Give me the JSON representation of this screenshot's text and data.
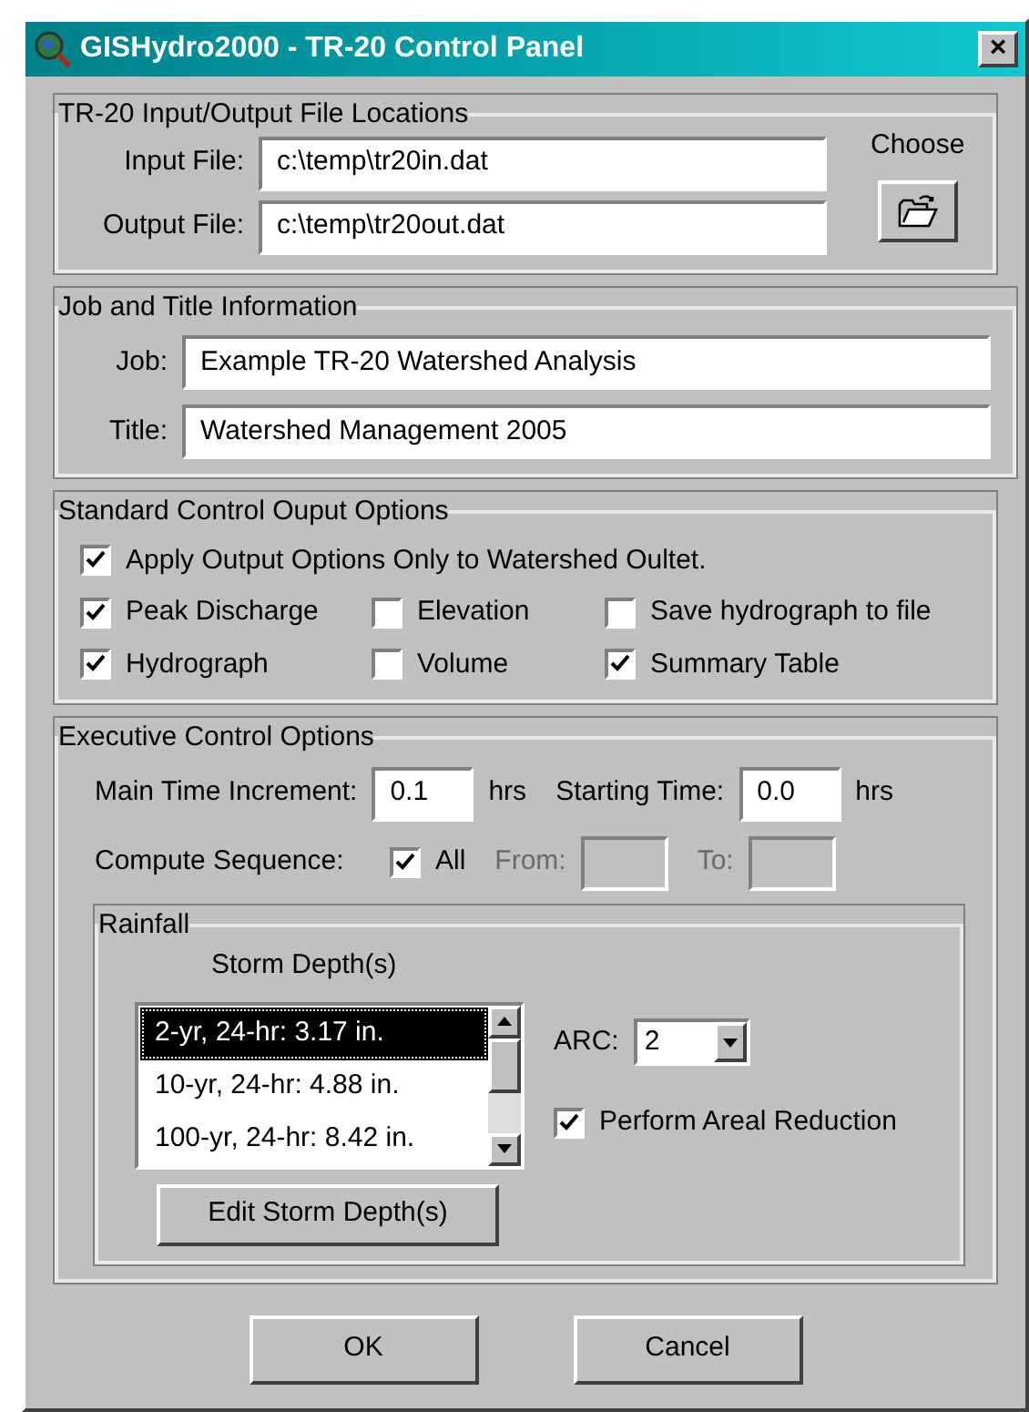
{
  "window": {
    "title": "GISHydro2000 - TR-20 Control Panel",
    "close": "×"
  },
  "file_locations": {
    "title": "TR-20 Input/Output File Locations",
    "fields": [
      {
        "label": "Input File:",
        "value": "c:\\temp\\tr20in.dat"
      },
      {
        "label": "Output File:",
        "value": "c:\\temp\\tr20out.dat"
      }
    ],
    "choose_label": "Choose"
  },
  "job_info": {
    "title": "Job and Title Information",
    "fields": [
      {
        "label": "Job:",
        "value": "Example TR-20 Watershed Analysis"
      },
      {
        "label": "Title:",
        "value": "Watershed Management 2005"
      }
    ]
  },
  "output_options": {
    "title": "Standard Control Ouput Options",
    "apply": {
      "label": "Apply Output Options Only to Watershed Oultet.",
      "checked": true
    },
    "options": [
      {
        "label": "Peak Discharge",
        "checked": true
      },
      {
        "label": "Elevation",
        "checked": false
      },
      {
        "label": "Save hydrograph to file",
        "checked": false
      },
      {
        "label": "Hydrograph",
        "checked": true
      },
      {
        "label": "Volume",
        "checked": false
      },
      {
        "label": "Summary Table",
        "checked": true
      }
    ]
  },
  "executive": {
    "title": "Executive Control Options",
    "main_time_increment": {
      "label": "Main Time Increment:",
      "value": "0.1",
      "unit": "hrs"
    },
    "starting_time": {
      "label": "Starting Time:",
      "value": "0.0",
      "unit": "hrs"
    },
    "compute_sequence": {
      "label": "Compute Sequence:",
      "all": {
        "label": "All",
        "checked": true
      },
      "range": [
        {
          "label": "From:",
          "disabled": true
        },
        {
          "label": "To:",
          "disabled": true
        }
      ]
    },
    "rainfall": {
      "title": "Rainfall",
      "storm_depths_label": "Storm Depth(s)",
      "storm_depths": [
        {
          "label": "2-yr, 24-hr: 3.17 in.",
          "selected": true
        },
        {
          "label": "10-yr, 24-hr: 4.88 in.",
          "selected": false
        },
        {
          "label": "100-yr, 24-hr: 8.42 in.",
          "selected": false
        }
      ],
      "edit_button": "Edit Storm Depth(s)",
      "arc": {
        "label": "ARC:",
        "value": "2"
      },
      "areal_reduction": {
        "label": "Perform Areal Reduction",
        "checked": true
      }
    }
  },
  "buttons": [
    "OK",
    "Cancel"
  ]
}
